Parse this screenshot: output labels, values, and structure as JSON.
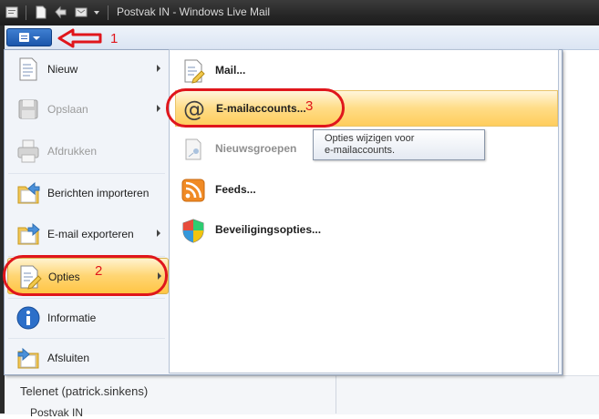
{
  "window": {
    "title": "Postvak IN - Windows Live Mail"
  },
  "menu_left": [
    {
      "label": "Nieuw",
      "icon": "new-document-icon",
      "submenu": true,
      "enabled": true,
      "selected": false
    },
    {
      "label": "Opslaan",
      "icon": "save-disk-icon",
      "submenu": true,
      "enabled": false,
      "selected": false
    },
    {
      "label": "Afdrukken",
      "icon": "printer-icon",
      "submenu": false,
      "enabled": false,
      "selected": false
    },
    {
      "label": "Berichten importeren",
      "icon": "import-folder-icon",
      "submenu": false,
      "enabled": true,
      "selected": false
    },
    {
      "label": "E-mail exporteren",
      "icon": "export-folder-icon",
      "submenu": true,
      "enabled": true,
      "selected": false
    },
    {
      "label": "Opties",
      "icon": "options-icon",
      "submenu": true,
      "enabled": true,
      "selected": true
    },
    {
      "label": "Informatie",
      "icon": "info-icon",
      "submenu": false,
      "enabled": true,
      "selected": false
    },
    {
      "label": "Afsluiten",
      "icon": "exit-folder-icon",
      "submenu": false,
      "enabled": true,
      "selected": false
    }
  ],
  "menu_right": [
    {
      "label": "Mail...",
      "icon": "mail-options-icon",
      "enabled": true,
      "highlighted": false
    },
    {
      "label": "E-mailaccounts...",
      "icon": "at-sign-icon",
      "enabled": true,
      "highlighted": true
    },
    {
      "label": "Nieuwsgroepen",
      "icon": "newsgroups-icon",
      "enabled": false,
      "highlighted": false
    },
    {
      "label": "Feeds...",
      "icon": "rss-feed-icon",
      "enabled": true,
      "highlighted": false
    },
    {
      "label": "Beveiligingsopties...",
      "icon": "security-shield-icon",
      "enabled": true,
      "highlighted": false
    }
  ],
  "tooltip": {
    "line1": "Opties wijzigen voor",
    "line2": "e-mailaccounts."
  },
  "background": {
    "folder_account": "Telenet (patrick.sinkens)",
    "folder_inbox": "Postvak IN"
  },
  "annotations": {
    "step1": "1",
    "step2": "2",
    "step3": "3",
    "color": "#e0161c"
  },
  "colors": {
    "accent": "#1b56ab",
    "selection": "#ffc545",
    "annotation": "#e0161c"
  }
}
